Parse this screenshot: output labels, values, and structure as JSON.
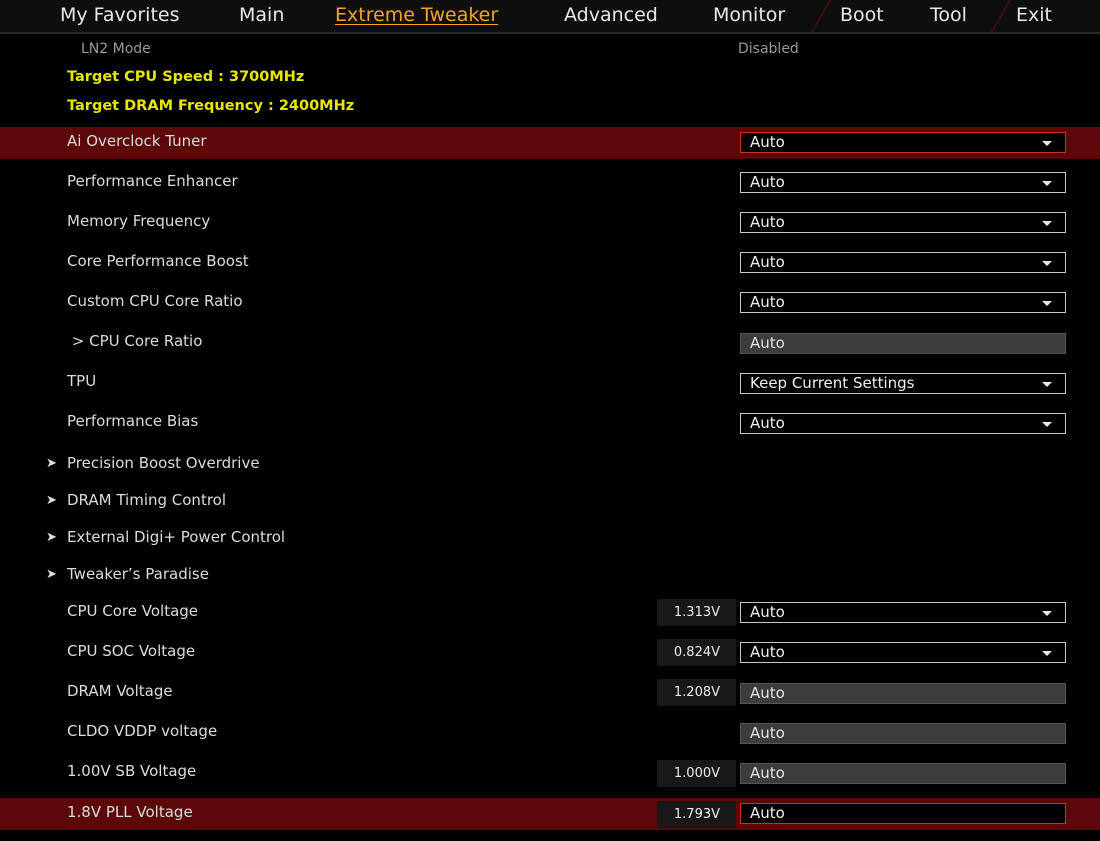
{
  "tabs": [
    {
      "label": "My Favorites",
      "active": false
    },
    {
      "label": "Main",
      "active": false
    },
    {
      "label": "Extreme Tweaker",
      "active": true
    },
    {
      "label": "Advanced",
      "active": false
    },
    {
      "label": "Monitor",
      "active": false
    },
    {
      "label": "Boot",
      "active": false
    },
    {
      "label": "Tool",
      "active": false
    },
    {
      "label": "Exit",
      "active": false
    }
  ],
  "ln2": {
    "label": "LN2 Mode",
    "value": "Disabled"
  },
  "info": {
    "cpu_speed": "Target CPU Speed : 3700MHz",
    "dram_freq": "Target DRAM Frequency : 2400MHz"
  },
  "settings": [
    {
      "label": "Ai Overclock Tuner",
      "value": "Auto"
    },
    {
      "label": "Performance Enhancer",
      "value": "Auto"
    },
    {
      "label": "Memory Frequency",
      "value": "Auto"
    },
    {
      "label": "Core Performance Boost",
      "value": "Auto"
    },
    {
      "label": "Custom CPU Core Ratio",
      "value": "Auto"
    },
    {
      "label": " > CPU Core Ratio",
      "value": "Auto"
    },
    {
      "label": "TPU",
      "value": "Keep Current Settings"
    },
    {
      "label": "Performance Bias",
      "value": "Auto"
    }
  ],
  "submenus": [
    {
      "label": "Precision Boost Overdrive"
    },
    {
      "label": "DRAM Timing Control"
    },
    {
      "label": "External Digi+ Power Control"
    },
    {
      "label": "Tweaker’s Paradise"
    }
  ],
  "submenu_arrow": "➤",
  "voltages": [
    {
      "label": "CPU Core Voltage",
      "reading": "1.313V",
      "value": "Auto"
    },
    {
      "label": "CPU SOC Voltage",
      "reading": "0.824V",
      "value": "Auto"
    },
    {
      "label": "DRAM Voltage",
      "reading": "1.208V",
      "value": "Auto"
    },
    {
      "label": "CLDO VDDP voltage",
      "reading": "",
      "value": "Auto"
    },
    {
      "label": "1.00V SB Voltage",
      "reading": "1.000V",
      "value": "Auto"
    },
    {
      "label": "1.8V PLL Voltage",
      "reading": "1.793V",
      "value": "Auto"
    }
  ],
  "colors": {
    "accent": "#f5a623",
    "info_text": "#e6e600",
    "selected_row": "#5c0808"
  }
}
